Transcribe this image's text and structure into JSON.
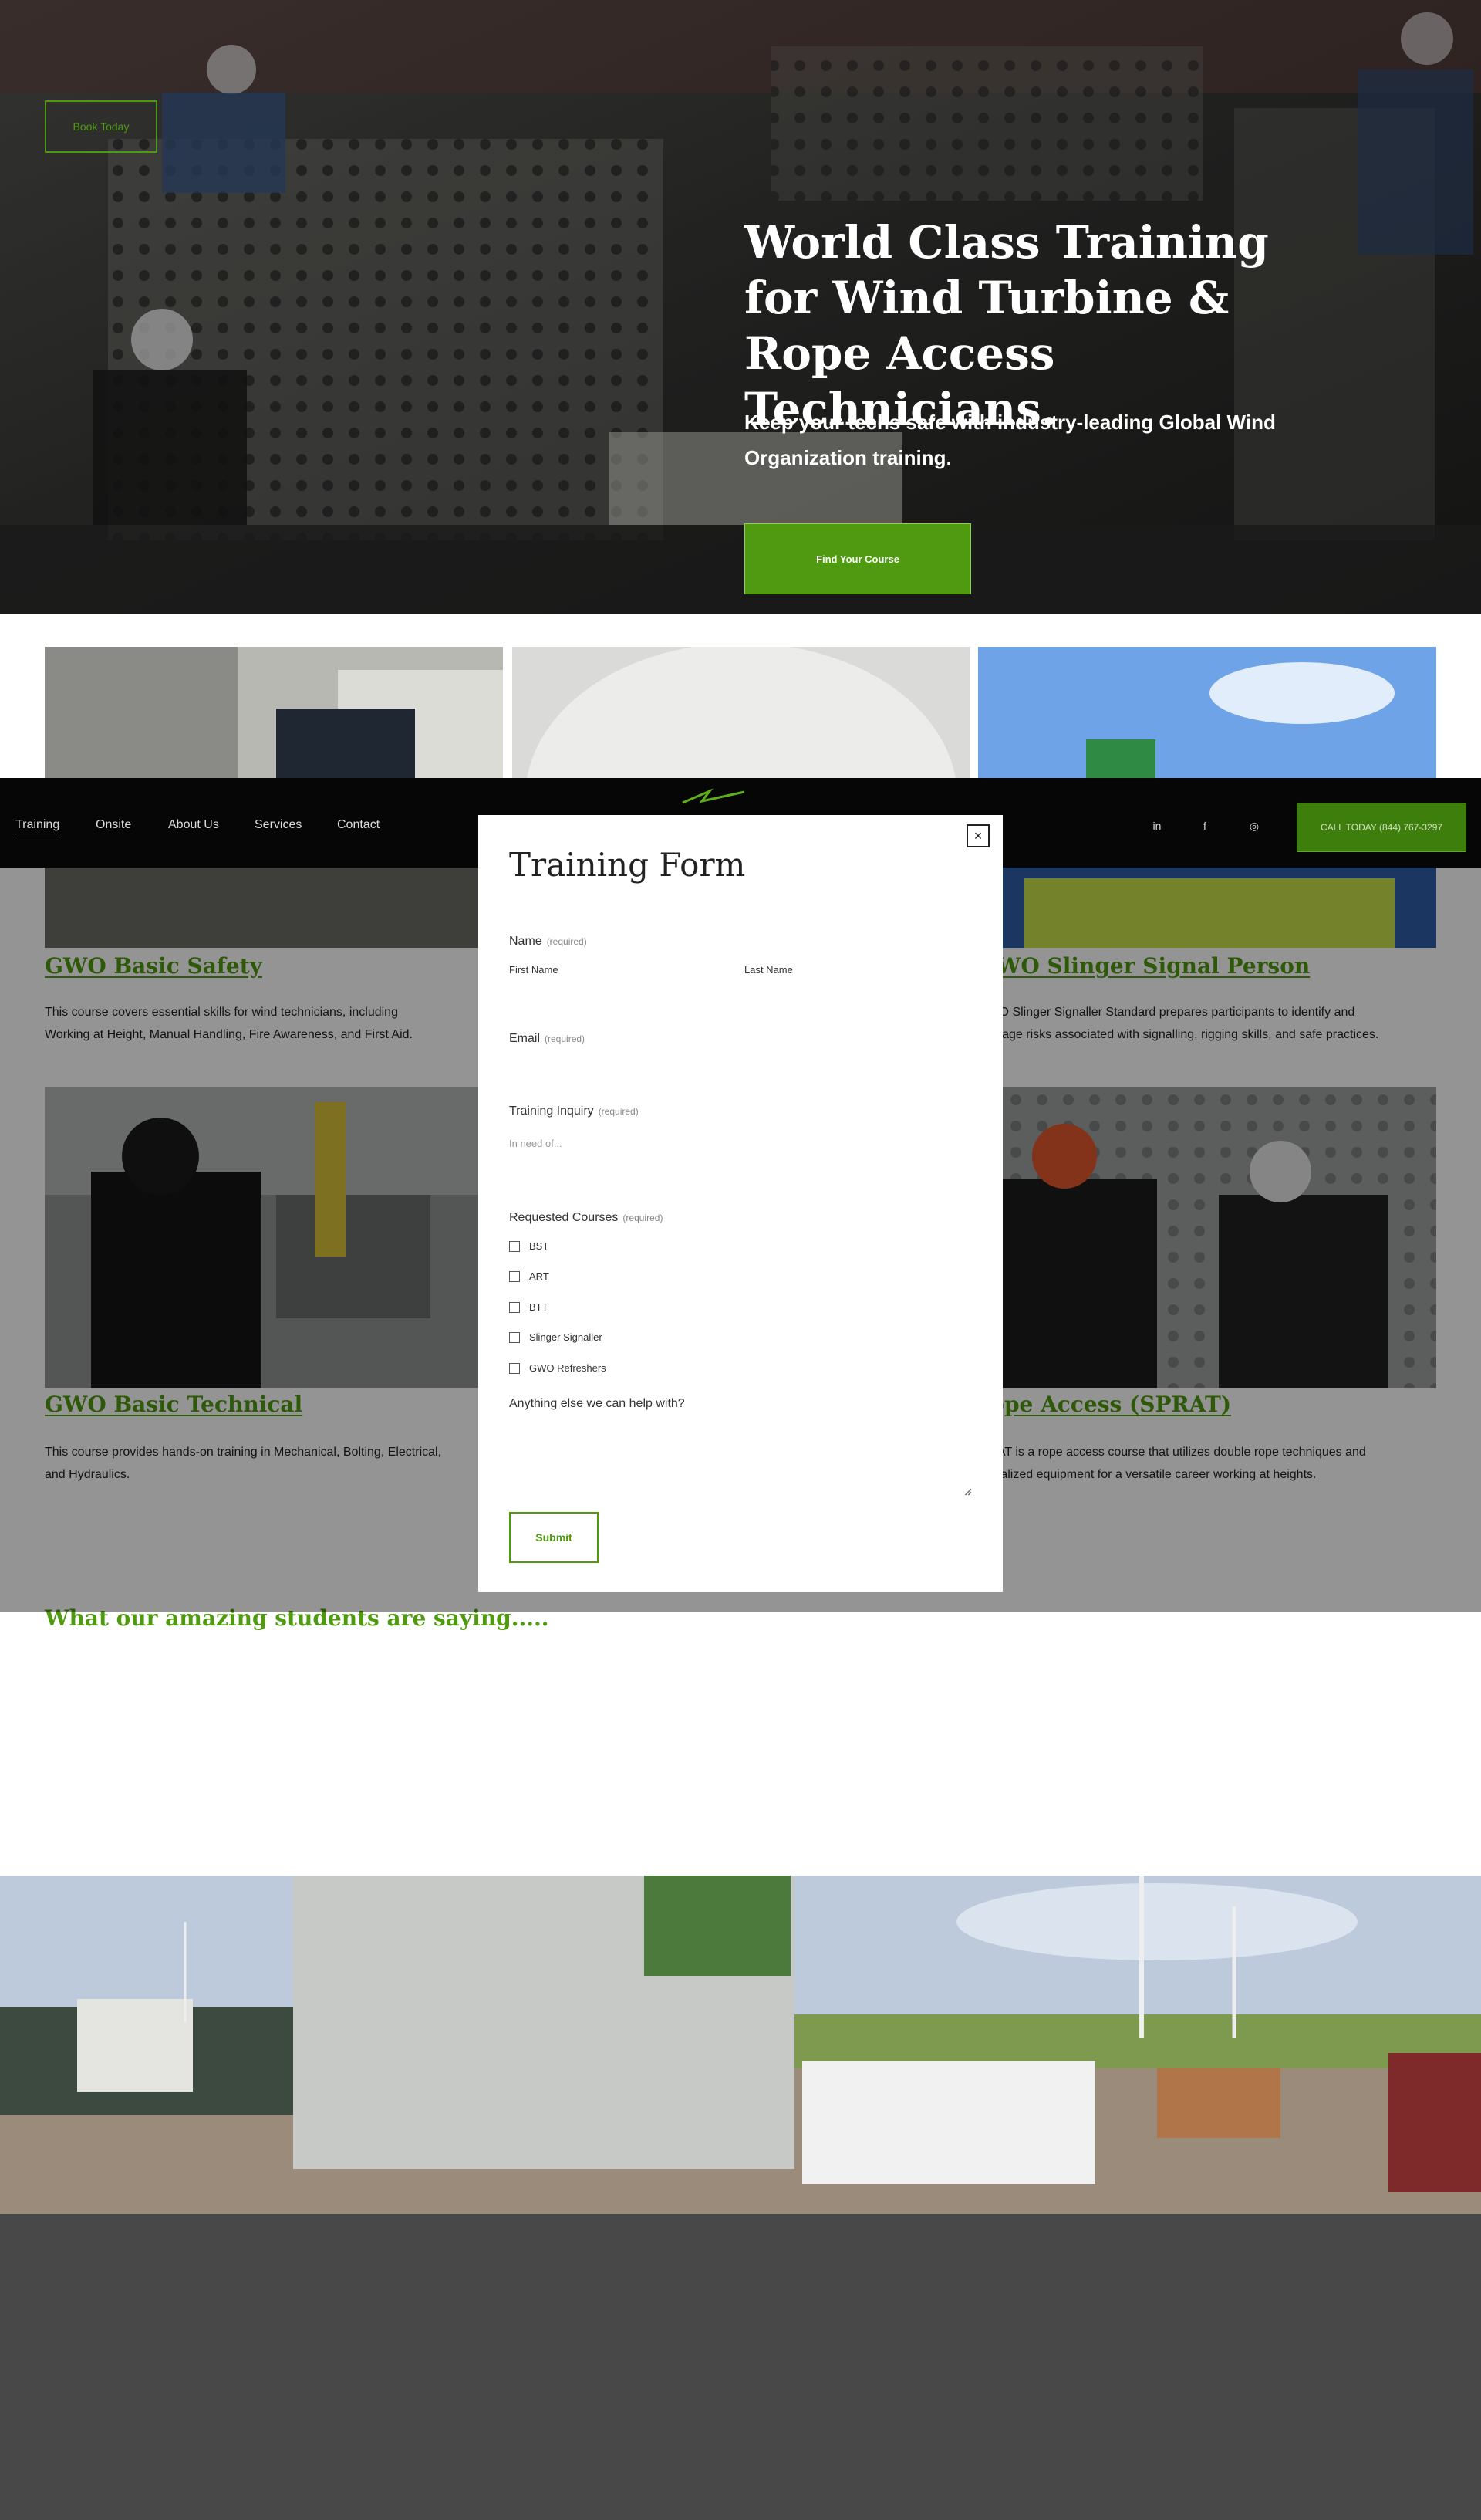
{
  "hero": {
    "book_today": "Book Today",
    "title": "World Class Training for Wind Turbine & Rope Access Technicians.",
    "subtitle": "Keep your techs safe with industry-leading Global Wind Organization training.",
    "cta": "Find Your Course"
  },
  "courses": [
    {
      "title": "GWO Basic Safety",
      "description": "This course covers essential skills for wind technicians, including Working at Height, Manual Handling, Fire Awareness, and First Aid."
    },
    {
      "title": "GWO Slinger Signal Person",
      "description": "GWO Slinger Signaller Standard prepares participants to identify and manage risks associated with signalling, rigging skills, and safe practices."
    },
    {
      "title": "GWO Basic Technical",
      "description": "This course provides hands-on training in Mechanical, Bolting, Electrical, and Hydraulics."
    },
    {
      "title": "Rope Access (SPRAT)",
      "description": "SPRAT is a rope access course that utilizes double rope techniques and specialized equipment for a versatile career working at heights."
    }
  ],
  "testimonials": {
    "heading": "What our amazing students are saying....."
  },
  "nav": {
    "items": [
      "Training",
      "Onsite",
      "About Us",
      "Services",
      "Contact"
    ],
    "social": [
      "in",
      "f",
      "◎"
    ],
    "call": "CALL TODAY (844) 767-3297"
  },
  "form": {
    "title": "Training Form",
    "close": "×",
    "required": "(required)",
    "name_label": "Name",
    "first_name": "First Name",
    "last_name": "Last Name",
    "email_label": "Email",
    "inquiry_label": "Training Inquiry",
    "inquiry_placeholder": "In need of...",
    "courses_label": "Requested Courses",
    "course_options": [
      "BST",
      "ART",
      "BTT",
      "Slinger Signaller",
      "GWO Refreshers"
    ],
    "other_label": "Anything else we can help with?",
    "submit": "Submit"
  },
  "colors": {
    "brand_green": "#4f9a10",
    "nav_bg": "#060606",
    "footer_bg": "#484848"
  }
}
